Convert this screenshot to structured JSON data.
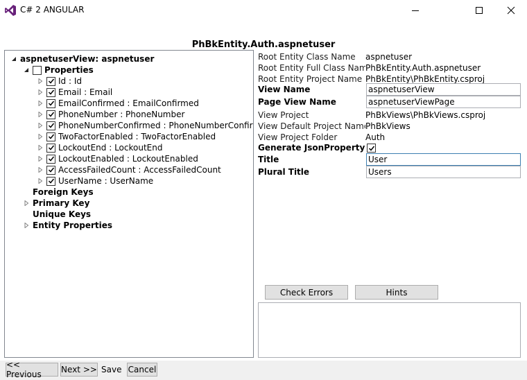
{
  "window": {
    "title": "C# 2 ANGULAR",
    "minimize_icon": "minimize-icon",
    "maximize_icon": "maximize-icon",
    "close_icon": "close-icon"
  },
  "page_title": "PhBkEntity.Auth.aspnetuser",
  "tree": {
    "root": {
      "label": "aspnetuserView: aspnetuser",
      "expanded": true
    },
    "properties": {
      "label": "Properties",
      "checked": false,
      "expanded": true,
      "items": [
        {
          "label": "Id : Id",
          "checked": true
        },
        {
          "label": "Email : Email",
          "checked": true
        },
        {
          "label": "EmailConfirmed : EmailConfirmed",
          "checked": true
        },
        {
          "label": "PhoneNumber : PhoneNumber",
          "checked": true
        },
        {
          "label": "PhoneNumberConfirmed : PhoneNumberConfirmed",
          "checked": true
        },
        {
          "label": "TwoFactorEnabled : TwoFactorEnabled",
          "checked": true
        },
        {
          "label": "LockoutEnd : LockoutEnd",
          "checked": true
        },
        {
          "label": "LockoutEnabled : LockoutEnabled",
          "checked": true
        },
        {
          "label": "AccessFailedCount : AccessFailedCount",
          "checked": true
        },
        {
          "label": "UserName : UserName",
          "checked": true
        }
      ]
    },
    "foreign_keys": "Foreign Keys",
    "primary_key": "Primary Key",
    "unique_keys": "Unique Keys",
    "entity_properties": "Entity Properties"
  },
  "props": {
    "root_class_name": {
      "label": "Root Entity Class Name",
      "value": "aspnetuser"
    },
    "root_full_class_name": {
      "label": "Root Entity Full Class Name",
      "value": "PhBkEntity.Auth.aspnetuser"
    },
    "root_project_name": {
      "label": "Root Entity Project Name",
      "value": "PhBkEntity\\PhBkEntity.csproj"
    },
    "view_name": {
      "label": "View Name",
      "value": "aspnetuserView"
    },
    "page_view_name": {
      "label": "Page View Name",
      "value": "aspnetuserViewPage"
    },
    "view_project": {
      "label": "View Project",
      "value": "PhBkViews\\PhBkViews.csproj"
    },
    "view_default_ns": {
      "label": "View Default Project NameSpace",
      "value": "PhBkViews"
    },
    "view_project_folder": {
      "label": "View Project Folder",
      "value": "Auth"
    },
    "generate_json": {
      "label": "Generate JsonProperty Attribute",
      "checked": true
    },
    "title": {
      "label": "Title",
      "value": "User"
    },
    "plural_title": {
      "label": "Plural Title",
      "value": "Users"
    }
  },
  "buttons": {
    "check_errors": "Check Errors",
    "hints": "Hints"
  },
  "footer": {
    "previous": "<< Previous",
    "next": "Next >>",
    "save": "Save",
    "cancel": "Cancel"
  },
  "colors": {
    "accent": "#68217a",
    "border": "#828790",
    "button_bg": "#e1e1e1",
    "footer_bg": "#f0f0f0"
  }
}
